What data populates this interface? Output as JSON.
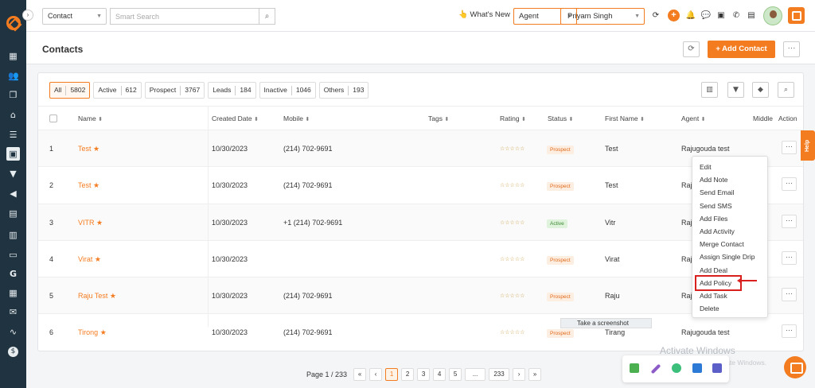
{
  "sidebar": {
    "collapse_glyph": "›",
    "icons": [
      "dashboard-icon",
      "contacts-icon",
      "documents-icon",
      "bank-icon",
      "list-icon",
      "person-card-icon",
      "filter-funnel-icon",
      "megaphone-icon",
      "book-icon",
      "chart-icon",
      "folder-icon",
      "google-icon",
      "calendar-icon",
      "mail-icon",
      "signature-icon",
      "dollar-icon"
    ]
  },
  "topbar": {
    "contact_select": "Contact",
    "search_placeholder": "Smart Search",
    "whats_new": "What's New",
    "agent_select": "Agent",
    "user_select": "Priyam Singh"
  },
  "header": {
    "title": "Contacts",
    "add_contact": "+   Add Contact",
    "more": "···"
  },
  "filters": [
    {
      "label": "All",
      "count": "5802"
    },
    {
      "label": "Active",
      "count": "612"
    },
    {
      "label": "Prospect",
      "count": "3767"
    },
    {
      "label": "Leads",
      "count": "184"
    },
    {
      "label": "Inactive",
      "count": "1046"
    },
    {
      "label": "Others",
      "count": "193"
    }
  ],
  "table": {
    "headers": {
      "name": "Name",
      "created": "Created Date",
      "mobile": "Mobile",
      "tags": "Tags",
      "rating": "Rating",
      "status": "Status",
      "first_name": "First Name",
      "agent": "Agent",
      "middle": "Middle",
      "action": "Action"
    },
    "rows": [
      {
        "num": "1",
        "name": "Test",
        "created": "10/30/2023",
        "mobile": "(214) 702-9691",
        "status": "Prospect",
        "first_name": "Test",
        "agent": "Rajugouda test"
      },
      {
        "num": "2",
        "name": "Test",
        "created": "10/30/2023",
        "mobile": "(214) 702-9691",
        "status": "Prospect",
        "first_name": "Test",
        "agent": "Raju"
      },
      {
        "num": "3",
        "name": "VITR",
        "created": "10/30/2023",
        "mobile": "+1 (214) 702-9691",
        "status": "Active",
        "first_name": "Vitr",
        "agent": "Raju"
      },
      {
        "num": "4",
        "name": "Virat",
        "created": "10/30/2023",
        "mobile": "",
        "status": "Prospect",
        "first_name": "Virat",
        "agent": "Raju"
      },
      {
        "num": "5",
        "name": "Raju Test",
        "created": "10/30/2023",
        "mobile": "(214) 702-9691",
        "status": "Prospect",
        "first_name": "Raju",
        "agent": "Raju"
      },
      {
        "num": "6",
        "name": "Tirong",
        "created": "10/30/2023",
        "mobile": "(214) 702-9691",
        "status": "Prospect",
        "first_name": "Tirang",
        "agent": "Rajugouda test"
      }
    ],
    "rating_glyph": "☆☆☆☆☆",
    "star_glyph": "★",
    "action_glyph": "···"
  },
  "dropdown": {
    "items": [
      "Edit",
      "Add Note",
      "Send Email",
      "Send SMS",
      "Add Files",
      "Add Activity",
      "Merge Contact",
      "Assign Single Drip",
      "Add Deal",
      "Add Policy",
      "Add Task",
      "Delete"
    ],
    "highlighted": "Add Policy"
  },
  "help_tab": "Help",
  "tooltip": "Take a screenshot",
  "pagination": {
    "label": "Page 1 / 233",
    "pages": [
      "«",
      "‹",
      "1",
      "2",
      "3",
      "4",
      "5",
      "...",
      "233",
      "›",
      "»"
    ],
    "current": "1"
  },
  "watermark": {
    "title": "Activate Windows",
    "subtitle": "Go to Settings to activate Windows."
  },
  "colors": {
    "accent": "#f47c20",
    "sidebar": "#1f3340",
    "highlight_red": "#d9201f"
  }
}
